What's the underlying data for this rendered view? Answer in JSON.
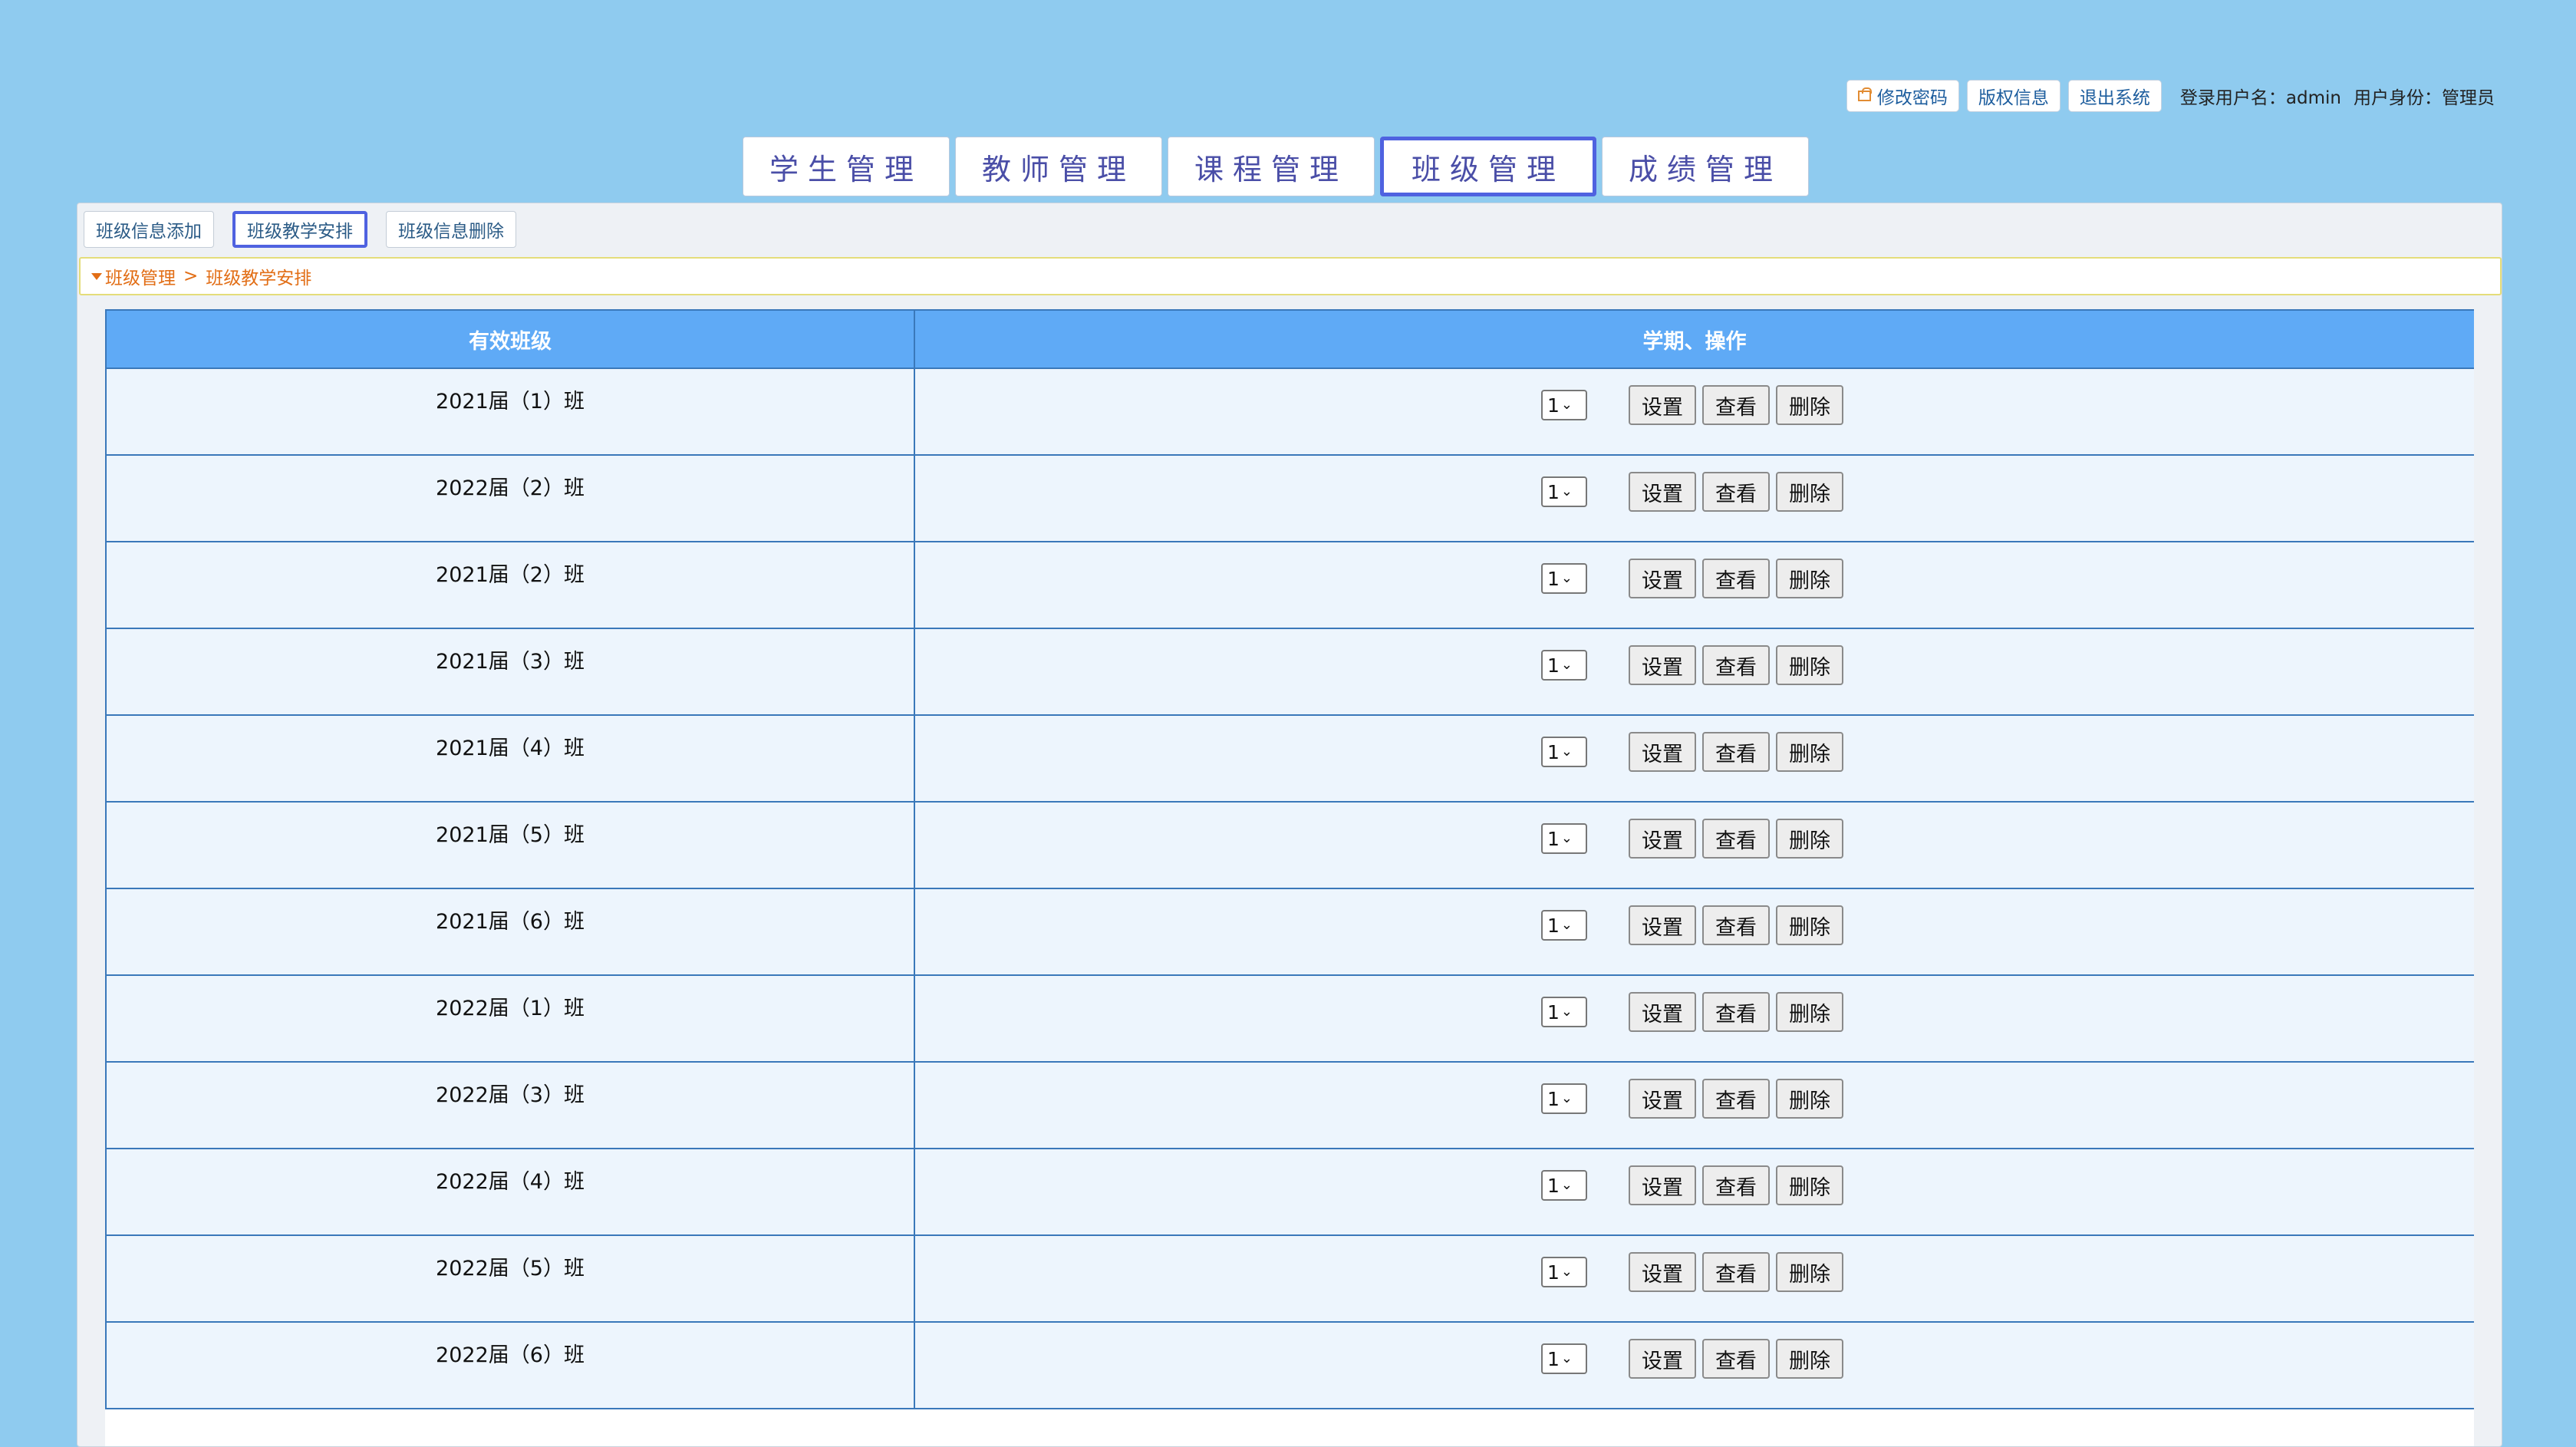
{
  "header": {
    "change_password": "修改密码",
    "copyright": "版权信息",
    "logout": "退出系统",
    "user_label": "登录用户名：",
    "username": "admin",
    "role_label": "用户身份：",
    "role": "管理员"
  },
  "nav": {
    "tabs": [
      {
        "label": "学生管理"
      },
      {
        "label": "教师管理"
      },
      {
        "label": "课程管理"
      },
      {
        "label": "班级管理"
      },
      {
        "label": "成绩管理"
      }
    ],
    "active_index": 3
  },
  "sub_toolbar": {
    "items": [
      {
        "label": "班级信息添加"
      },
      {
        "label": "班级教学安排"
      },
      {
        "label": "班级信息删除"
      }
    ],
    "active_index": 1
  },
  "breadcrumb": {
    "parent": "班级管理",
    "separator": ">",
    "current": "班级教学安排"
  },
  "table": {
    "headers": [
      "有效班级",
      "学期、操作"
    ],
    "action_labels": {
      "set": "设置",
      "view": "查看",
      "delete": "删除"
    },
    "rows": [
      {
        "class_name": "2021届（1）班",
        "term": "1"
      },
      {
        "class_name": "2022届（2）班",
        "term": "1"
      },
      {
        "class_name": "2021届（2）班",
        "term": "1"
      },
      {
        "class_name": "2021届（3）班",
        "term": "1"
      },
      {
        "class_name": "2021届（4）班",
        "term": "1"
      },
      {
        "class_name": "2021届（5）班",
        "term": "1"
      },
      {
        "class_name": "2021届（6）班",
        "term": "1"
      },
      {
        "class_name": "2022届（1）班",
        "term": "1"
      },
      {
        "class_name": "2022届（3）班",
        "term": "1"
      },
      {
        "class_name": "2022届（4）班",
        "term": "1"
      },
      {
        "class_name": "2022届（5）班",
        "term": "1"
      },
      {
        "class_name": "2022届（6）班",
        "term": "1"
      }
    ]
  },
  "colors": {
    "background": "#8fcbef",
    "table_header": "#5faaf6",
    "row_background": "#edf5fd",
    "active_border": "#4f62e0",
    "breadcrumb_text": "#e26e16"
  }
}
